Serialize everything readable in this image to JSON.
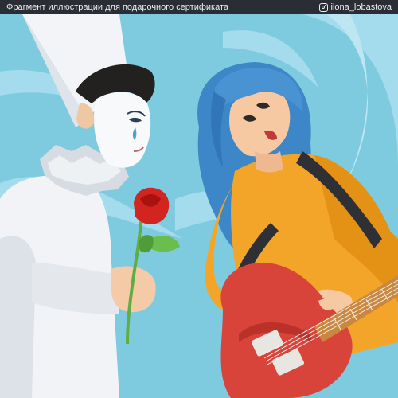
{
  "caption": {
    "left_text": "Фрагмент иллюстрации для подарочного сертификата",
    "handle": "ilona_lobastova",
    "icon": "instagram-icon"
  },
  "palette": {
    "sky": "#7ecbe0",
    "swirl": "#a9def0",
    "hair_blue": "#3d86c8",
    "sweater": "#f3a529",
    "guitar": "#d9443a",
    "rose": "#d3241f",
    "leaf": "#6bbd4d"
  }
}
